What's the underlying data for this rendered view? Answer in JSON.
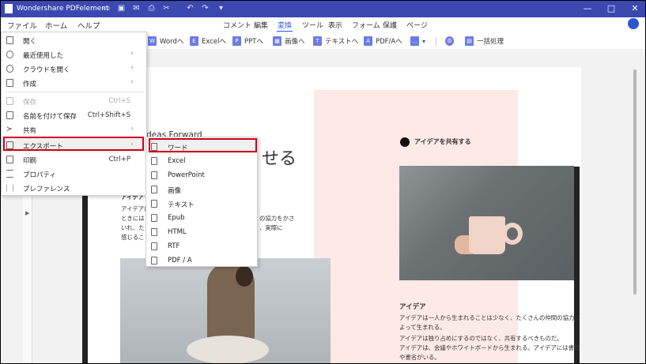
{
  "titlebar": {
    "app_title": "Wondershare PDFelement",
    "quick_access": [
      "folder-icon",
      "save-icon",
      "mail-icon",
      "print-icon",
      "scissors-icon",
      "undo-icon",
      "redo-icon",
      "dropdown-icon"
    ],
    "window_controls": [
      "minimize",
      "maximize",
      "close"
    ]
  },
  "menubar": {
    "left": [
      "ファイル",
      "ホーム",
      "ヘルプ"
    ],
    "tabs": [
      "コメント",
      "編集",
      "変換",
      "ツール",
      "表示",
      "フォーム",
      "保護",
      "ページ"
    ],
    "active_tab": "変換"
  },
  "toolbar": {
    "buttons": [
      "Wordへ",
      "Excelへ",
      "PPTへ",
      "画像へ",
      "テキストへ",
      "PDF/Aへ"
    ],
    "batch_label": "一括処理"
  },
  "file_menu": {
    "items": [
      {
        "label": "開く",
        "shortcut": "",
        "submenu": false,
        "disabled": false,
        "icon": "open-icon"
      },
      {
        "label": "最近使用した",
        "shortcut": "",
        "submenu": true,
        "disabled": false,
        "icon": "clock-icon"
      },
      {
        "label": "クラウドを開く",
        "shortcut": "",
        "submenu": true,
        "disabled": false,
        "icon": "cloud-icon"
      },
      {
        "label": "作成",
        "shortcut": "",
        "submenu": true,
        "disabled": false,
        "icon": "create-icon"
      },
      {
        "label": "保存",
        "shortcut": "Ctrl+S",
        "submenu": false,
        "disabled": true,
        "icon": "save-icon"
      },
      {
        "label": "名前を付けて保存",
        "shortcut": "Ctrl+Shift+S",
        "submenu": false,
        "disabled": false,
        "icon": "save-as-icon"
      },
      {
        "label": "共有",
        "shortcut": "",
        "submenu": true,
        "disabled": false,
        "icon": "share-icon"
      },
      {
        "label": "エクスポート",
        "shortcut": "",
        "submenu": true,
        "disabled": false,
        "icon": "export-icon"
      },
      {
        "label": "印刷",
        "shortcut": "Ctrl+P",
        "submenu": false,
        "disabled": false,
        "icon": "print-icon"
      },
      {
        "label": "プロパティ",
        "shortcut": "",
        "submenu": false,
        "disabled": false,
        "icon": "properties-icon"
      },
      {
        "label": "プレファレンス",
        "shortcut": "",
        "submenu": false,
        "disabled": false,
        "icon": "preferences-icon"
      }
    ]
  },
  "export_submenu": {
    "items": [
      "ワード",
      "Excel",
      "PowerPoint",
      "画像",
      "テキスト",
      "Epub",
      "HTML",
      "RTF",
      "PDF / A"
    ]
  },
  "document": {
    "subtitle_en": "Ideas Forward",
    "big_heading_fragment": "せる",
    "share_heading": "アイデアを共有する",
    "left_section_title": "アイデア",
    "left_body": [
      "アイデアは",
      "ときには",
      "いれ、たくさ",
      "感じること"
    ],
    "left_body_right": [
      "の協力をかさ",
      "、実際に",
      ""
    ],
    "left_body_right_alt": [
      "す。実際に"
    ],
    "right_section_title": "アイデア",
    "right_body": [
      "アイデアは一人から生まれることは少なく、たくさんの仲間の協力に",
      "よって生まれる。",
      "アイデアは独り占めにするのではなく、共有するべきものだ。",
      "アイデアは、会議やホワイトボードから生まれる。アイデアには書類",
      "や書名がいる。"
    ]
  },
  "colors": {
    "titlebar_bg": "#3a48b0",
    "accent": "#2f55d4",
    "highlight": "#d0021b",
    "pink_panel": "#fde9e6"
  }
}
